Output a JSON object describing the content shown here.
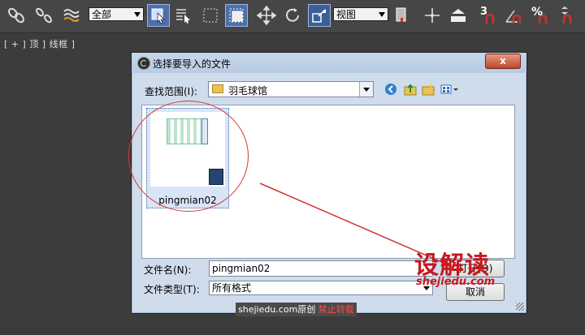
{
  "toolbar": {
    "filter_select": "全部",
    "view_select": "视图",
    "snap_3": "3",
    "percent": "%"
  },
  "viewport": {
    "label": "[ + ] 顶 ] 线框 ]"
  },
  "dialog": {
    "title": "选择要导入的文件",
    "close_label": "x",
    "look_in_label": "查找范围(I):",
    "look_in_value": "羽毛球馆",
    "files": [
      {
        "name": "pingmian02"
      }
    ],
    "file_name_label": "文件名(N):",
    "file_name_value": "pingmian02",
    "file_type_label": "文件类型(T):",
    "file_type_value": "所有格式",
    "open_button": "打开(O)",
    "cancel_button": "取消"
  },
  "watermark": {
    "site": "shejiedu.com",
    "original": "原创",
    "forbid": "禁止转载"
  },
  "brand": {
    "cn": "设解读",
    "en": "shejiedu.com"
  },
  "colors": {
    "annotation_red": "#d33333",
    "selection_blue": "#d7e5f7"
  }
}
